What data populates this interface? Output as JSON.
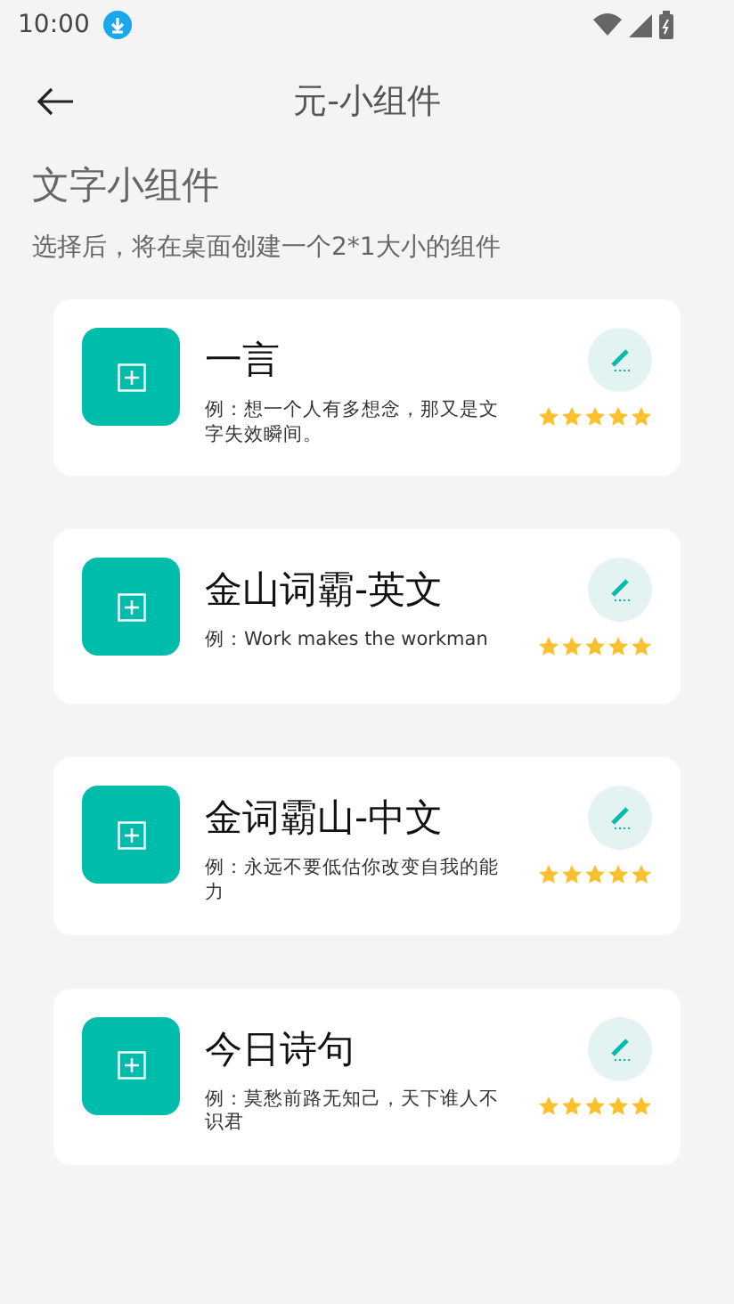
{
  "status_bar": {
    "time": "10:00"
  },
  "app_bar": {
    "title": "元-小组件"
  },
  "section": {
    "title": "文字小组件",
    "description": "选择后，将在桌面创建一个2*1大小的组件"
  },
  "widgets": [
    {
      "name": "一言",
      "example": "例：想一个人有多想念，那又是文字失效瞬间。",
      "stars": 5
    },
    {
      "name": "金山词霸-英文",
      "example": "例：Work makes the workman",
      "stars": 5
    },
    {
      "name": "金词霸山-中文",
      "example": "例：永远不要低估你改变自我的能力",
      "stars": 5
    },
    {
      "name": "今日诗句",
      "example": "例：莫愁前路无知己，天下谁人不识君",
      "stars": 5
    }
  ]
}
